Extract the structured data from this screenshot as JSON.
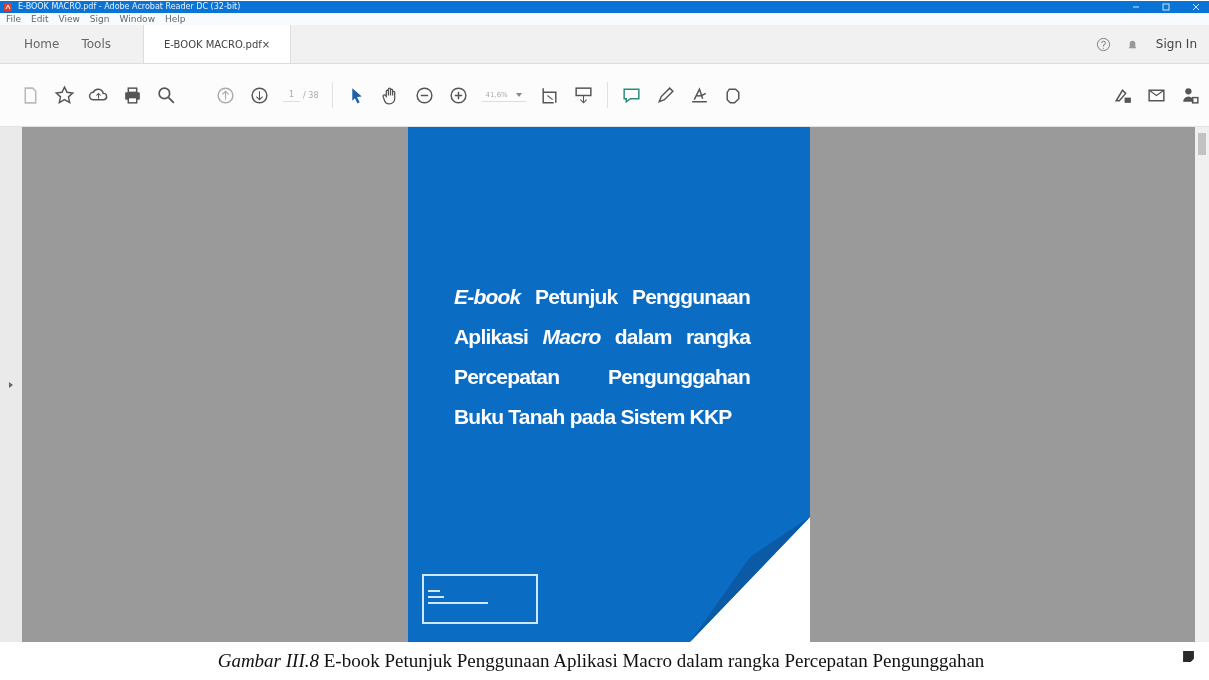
{
  "window": {
    "title": "E-BOOK MACRO.pdf - Adobe Acrobat Reader DC (32-bit)"
  },
  "menu": [
    "File",
    "Edit",
    "View",
    "Sign",
    "Window",
    "Help"
  ],
  "tabs": [
    {
      "label": "Home",
      "selected": false
    },
    {
      "label": "Tools",
      "selected": false
    },
    {
      "label": "E-BOOK MACRO.pdf",
      "selected": true,
      "close": "×"
    }
  ],
  "sign_in": "Sign In",
  "toolbar": {
    "page": "1",
    "page_count": "/ 38",
    "zoom": "41,6%"
  },
  "document": {
    "cover_title": "*E-book* Petunjuk Penggunaan Aplikasi *Macro* dalam rangka Percepatan Pengunggahan Buku Tanah pada Sistem KKP"
  },
  "caption": {
    "label": "Gambar III.8",
    "text": "E-book Petunjuk Penggunaan Aplikasi Macro dalam rangka Percepatan Pengunggahan"
  }
}
